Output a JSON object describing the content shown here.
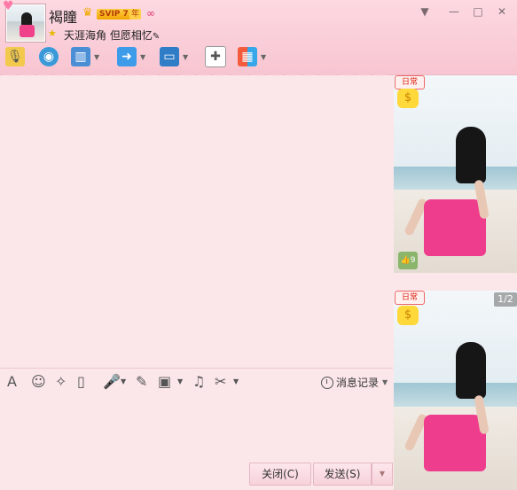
{
  "window": {
    "contact_name": "褐瞳",
    "svip_badge": "SVIP 7",
    "year_badge": "年",
    "signature": "天涯海角 但愿相忆",
    "signature_suffix_icon": "pen-icon",
    "controls": [
      "minimize-dropdown",
      "minimize",
      "maximize",
      "close"
    ]
  },
  "toolbar": {
    "icons": [
      "voice-call-icon",
      "video-call-icon",
      "remote-desktop-icon",
      "file-transfer-icon",
      "share-screen-icon",
      "create-discussion-icon",
      "apps-icon"
    ]
  },
  "format_bar": {
    "icons": [
      "font-icon",
      "emoji-icon",
      "magic-icon",
      "screen-shake-icon",
      "voice-message-icon",
      "sticky-note-icon",
      "image-icon",
      "music-icon",
      "screenshot-icon"
    ],
    "history_label": "消息记录"
  },
  "buttons": {
    "close_label": "关闭(C)",
    "send_label": "发送(S)"
  },
  "side_panel": {
    "badges": {
      "day_badge": "日常",
      "level": "9"
    },
    "pager": "1/2"
  },
  "colors": {
    "title_bg": "#f7c5d1",
    "chat_bg": "#fbe6e9",
    "dress": "#ef3d8d"
  }
}
